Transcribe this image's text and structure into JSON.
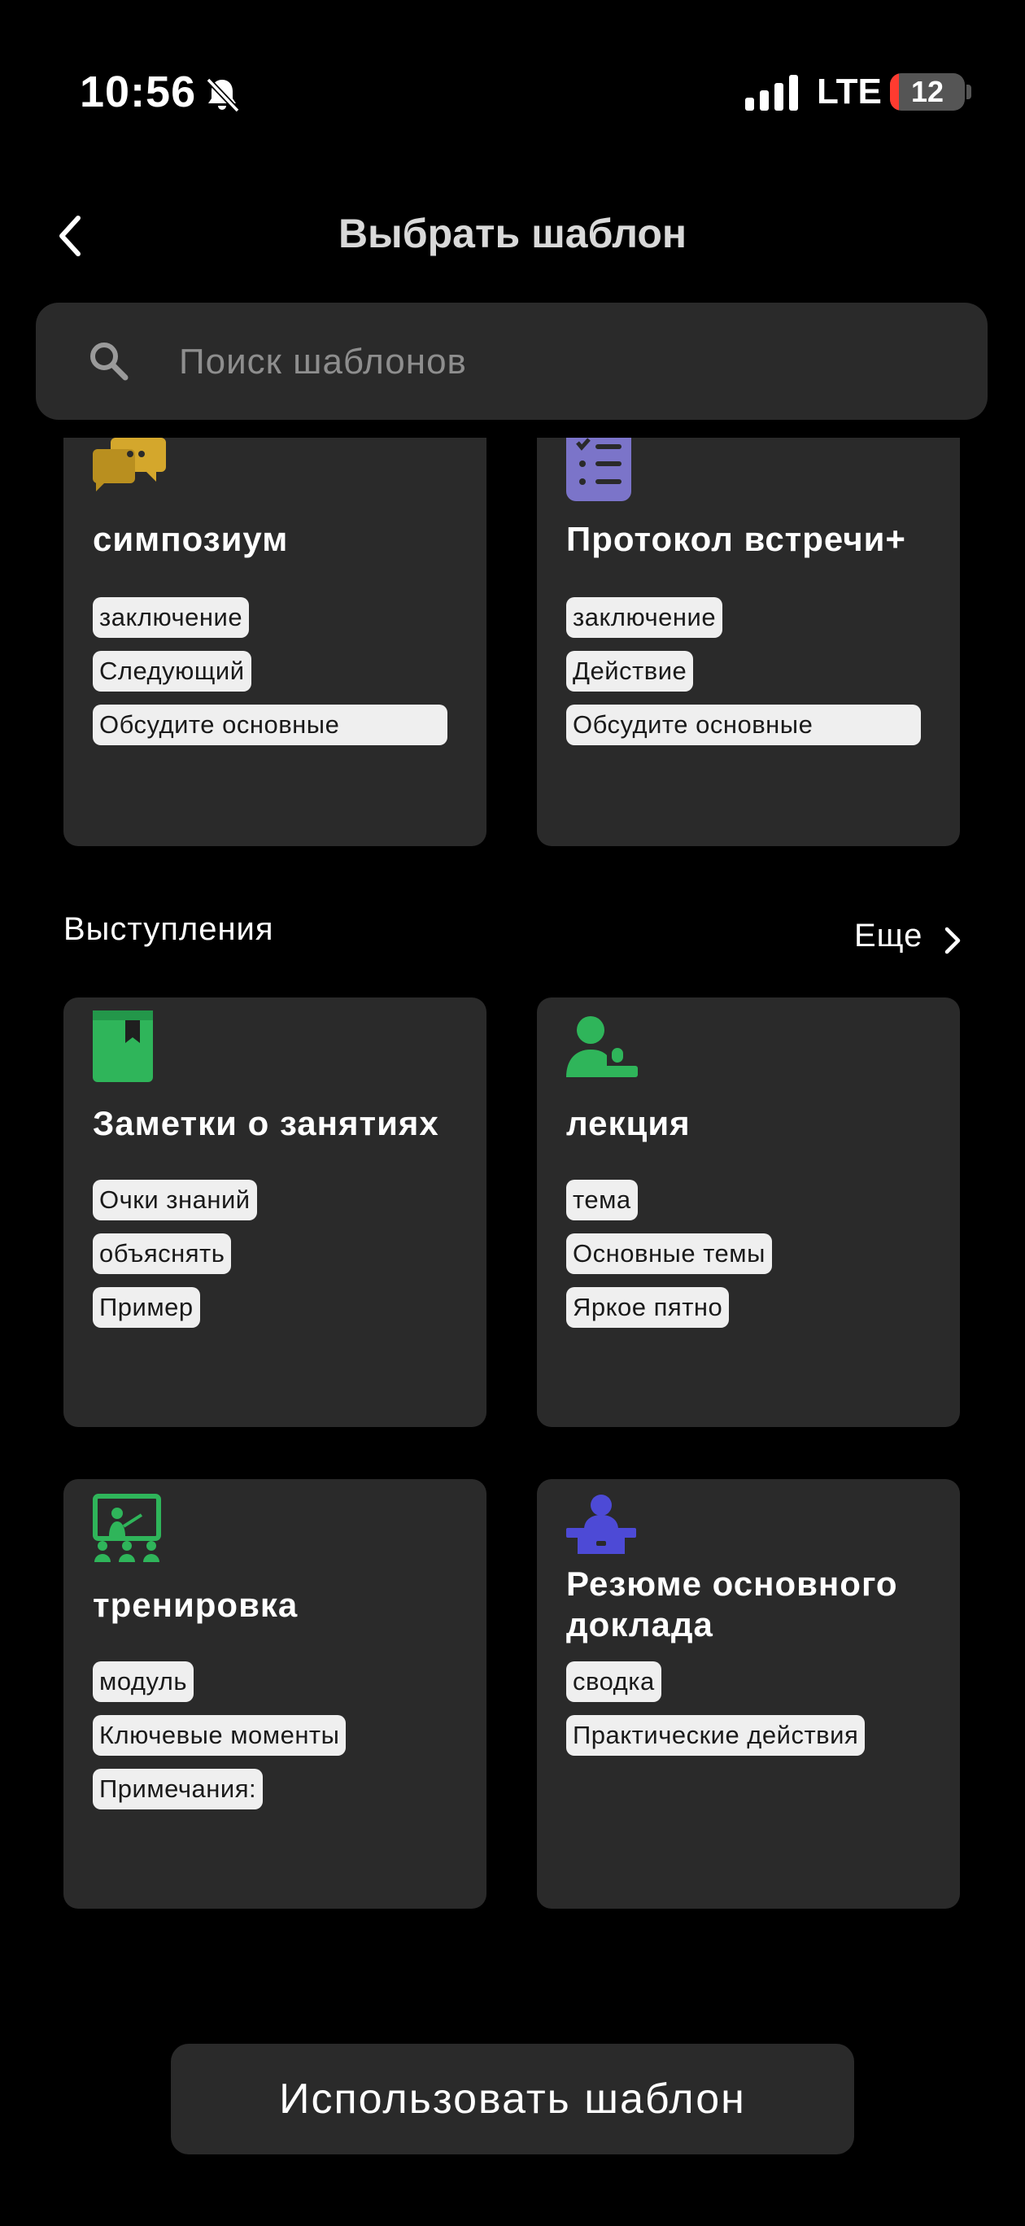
{
  "status_bar": {
    "time": "10:56",
    "network": "LTE",
    "battery": "12",
    "battery_level": 0.12
  },
  "header": {
    "title": "Выбрать шаблон"
  },
  "search": {
    "placeholder": "Поиск шаблонов"
  },
  "top_cards": [
    {
      "title": "симпозиум",
      "icon": "chat-bubbles-icon",
      "tags": [
        "заключение",
        "Следующий",
        "Обсудите основные"
      ]
    },
    {
      "title": "Протокол встречи+",
      "icon": "checklist-icon",
      "tags": [
        "заключение",
        "Действие",
        "Обсудите основные"
      ]
    }
  ],
  "section": {
    "title": "Выступления",
    "more_label": "Еще",
    "cards": [
      {
        "title": "Заметки о занятиях",
        "icon": "notebook-icon",
        "tags": [
          "Очки знаний",
          "объяснять",
          "Пример"
        ]
      },
      {
        "title": "лекция",
        "icon": "lecturer-icon",
        "tags": [
          "тема",
          "Основные темы",
          "Яркое пятно"
        ]
      },
      {
        "title": "тренировка",
        "icon": "training-board-icon",
        "tags": [
          "модуль",
          "Ключевые моменты",
          "Примечания:"
        ]
      },
      {
        "title_line1": "Резюме основного",
        "title_line2": "доклада",
        "icon": "speaker-podium-icon",
        "tags": [
          "сводка",
          "Практические действия"
        ]
      }
    ]
  },
  "footer": {
    "button_label": "Использовать шаблон"
  },
  "colors": {
    "background": "#000000",
    "card": "#2a2a2a",
    "tag": "#efefef",
    "yellow": "#d4a72c",
    "purple": "#7b74c9",
    "green": "#2fb55a",
    "indigo": "#4d4ad6"
  }
}
